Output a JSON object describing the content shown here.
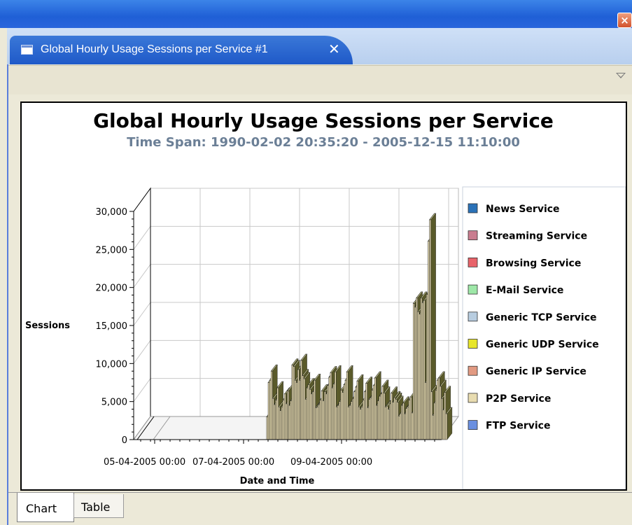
{
  "window": {
    "close_glyph": "×"
  },
  "editor_tab": {
    "title": "Global Hourly Usage Sessions per Service #1",
    "close_glyph": "✕",
    "icon": "document-icon"
  },
  "view_menu_icon": "view-menu-triangle-icon",
  "bottom_tabs": [
    "Chart",
    "Table"
  ],
  "chart_data": {
    "type": "bar",
    "title": "Global Hourly Usage Sessions per Service",
    "subtitle": "Time Span: 1990-02-02 20:35:20 - 2005-12-15 11:10:00",
    "xlabel": "Date and Time",
    "ylabel": "Sessions",
    "ylim": [
      0,
      30000
    ],
    "yticks": [
      "0",
      "5,000",
      "10,000",
      "15,000",
      "20,000",
      "25,000",
      "30,000"
    ],
    "xticks": [
      "05-04-2005 00:00",
      "07-04-2005 00:00",
      "09-04-2005 00:00"
    ],
    "grid": true,
    "legend_position": "right",
    "legend": [
      {
        "name": "News Service",
        "color": "#2a72b8"
      },
      {
        "name": "Streaming Service",
        "color": "#c97d8f"
      },
      {
        "name": "Browsing Service",
        "color": "#e8636a"
      },
      {
        "name": "E-Mail Service",
        "color": "#9ee8a8"
      },
      {
        "name": "Generic TCP Service",
        "color": "#b8cde0"
      },
      {
        "name": "Generic UDP Service",
        "color": "#e8e62a"
      },
      {
        "name": "Generic IP Service",
        "color": "#e29a82"
      },
      {
        "name": "P2P Service",
        "color": "#e8dcb0"
      },
      {
        "name": "FTP Service",
        "color": "#6a8fe0"
      }
    ],
    "series": [
      {
        "name": "P2P Service",
        "values": [
          0,
          0,
          0,
          0,
          0,
          0,
          0,
          0,
          0,
          0,
          0,
          0,
          0,
          0,
          0,
          0,
          0,
          0,
          0,
          0,
          0,
          0,
          0,
          0,
          0,
          0,
          0,
          0,
          0,
          0,
          0,
          0,
          0,
          0,
          0,
          0,
          0,
          0,
          0,
          0,
          0,
          0,
          0,
          0,
          0,
          0,
          0,
          0,
          0,
          0,
          0,
          0,
          0,
          0,
          0,
          0,
          0,
          0,
          0,
          0,
          0,
          0,
          0,
          0,
          0,
          0,
          0,
          0,
          0,
          0,
          0,
          0,
          0,
          0,
          0,
          0,
          0,
          0,
          0,
          0,
          0,
          0,
          0,
          0,
          0,
          0,
          3000,
          7500,
          7800,
          9000,
          5400,
          4600,
          5200,
          6800,
          4300,
          3800,
          4300,
          5200,
          6000,
          4700,
          6400,
          4500,
          5100,
          9800,
          9600,
          7800,
          7500,
          9200,
          7800,
          10400,
          8400,
          8000,
          5300,
          6800,
          7200,
          6600,
          6000,
          6300,
          7800,
          4200,
          4300,
          4600,
          5200,
          6400,
          5100,
          6300,
          6000,
          7100,
          8200,
          8800,
          6800,
          7300,
          8900,
          4300,
          4500,
          5000,
          6500,
          6200,
          7200,
          7800,
          8900,
          4300,
          4500,
          5000,
          5400,
          6300,
          6900,
          7700,
          4300,
          4000,
          4300,
          5200,
          6300,
          7400,
          4200,
          5300,
          5500,
          6500,
          7100,
          8100,
          4500,
          5100,
          5700,
          6000,
          7000,
          6100,
          4300,
          4400,
          4000,
          4700,
          6100,
          4900,
          5500,
          5300,
          4900,
          3100,
          3400,
          4500,
          4800,
          3400,
          4100,
          4300,
          5200,
          5600,
          3500,
          17900,
          17400,
          18600,
          16800,
          16500,
          18600,
          18000,
          18300,
          7500,
          19100,
          26100,
          28900,
          6300,
          3200,
          4800,
          6500,
          7800,
          8100,
          7000,
          5400,
          3900,
          6200,
          3400
        ]
      }
    ]
  }
}
